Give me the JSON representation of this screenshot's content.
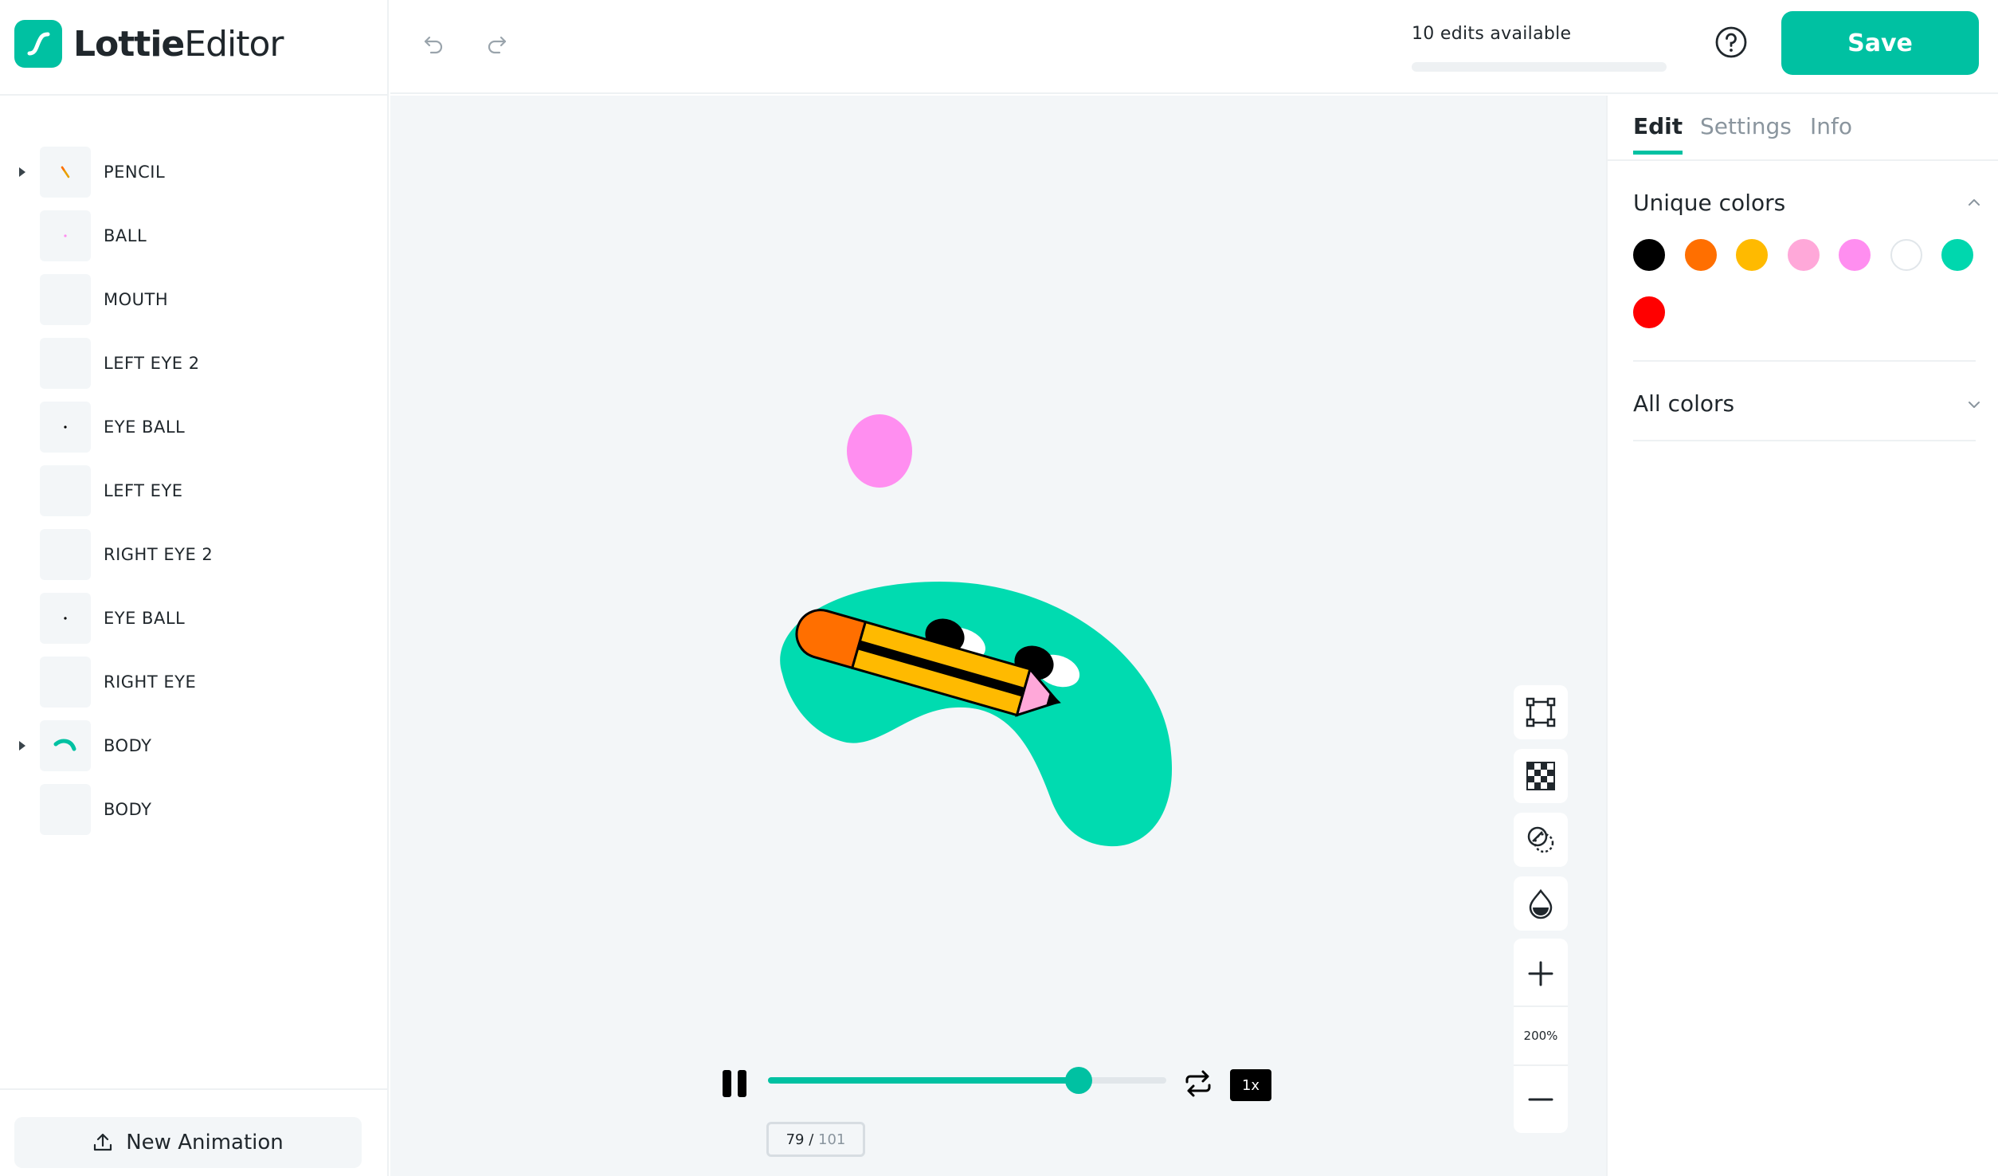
{
  "app": {
    "brand_bold": "Lottie",
    "brand_light": "Editor"
  },
  "toolbar": {
    "edits_label": "10 edits available",
    "edits_used_fraction": 0.0,
    "save_label": "Save",
    "undo_icon": "undo-icon",
    "redo_icon": "redo-icon",
    "help_icon": "help-icon"
  },
  "layers": [
    {
      "name": "PENCIL",
      "expandable": true,
      "thumb": "pencil"
    },
    {
      "name": "BALL",
      "expandable": false,
      "thumb": "dot-red"
    },
    {
      "name": "MOUTH",
      "expandable": false,
      "thumb": "none"
    },
    {
      "name": "LEFT EYE 2",
      "expandable": false,
      "thumb": "none"
    },
    {
      "name": "EYE BALL",
      "expandable": false,
      "thumb": "dot-black"
    },
    {
      "name": "LEFT EYE",
      "expandable": false,
      "thumb": "none"
    },
    {
      "name": "RIGHT EYE 2",
      "expandable": false,
      "thumb": "none"
    },
    {
      "name": "EYE BALL",
      "expandable": false,
      "thumb": "dot-black"
    },
    {
      "name": "RIGHT EYE",
      "expandable": false,
      "thumb": "none"
    },
    {
      "name": "BODY",
      "expandable": true,
      "thumb": "body"
    },
    {
      "name": "BODY",
      "expandable": false,
      "thumb": "none"
    }
  ],
  "sidebar_footer": {
    "new_animation_label": "New Animation",
    "icon": "upload-icon"
  },
  "canvas": {
    "zoom_level": "200%",
    "tools": [
      "bounding-box-icon",
      "transparency-grid-icon",
      "overlap-icon",
      "color-drop-icon"
    ],
    "zoom_in_icon": "plus-icon",
    "zoom_out_icon": "minus-icon"
  },
  "player": {
    "current_frame": "79",
    "frame_separator": " / ",
    "total_frames": "101",
    "progress_fraction": 0.78,
    "speed_label": "1x",
    "pause_icon": "pause-icon",
    "loop_icon": "loop-icon"
  },
  "right_panel": {
    "tabs": [
      {
        "label": "Edit",
        "active": true
      },
      {
        "label": "Settings",
        "active": false
      },
      {
        "label": "Info",
        "active": false
      }
    ],
    "unique_colors_title": "Unique colors",
    "unique_colors": [
      "#000000",
      "#FF6F00",
      "#FFBA00",
      "#FFA8D9",
      "#FF8EF0",
      "#FFFFFF",
      "#00D7AE",
      "#FF0000"
    ],
    "all_colors_title": "All colors"
  },
  "colors": {
    "accent": "#00C1A2",
    "body": "#00DBB0",
    "ball": "#FF8EF0"
  }
}
